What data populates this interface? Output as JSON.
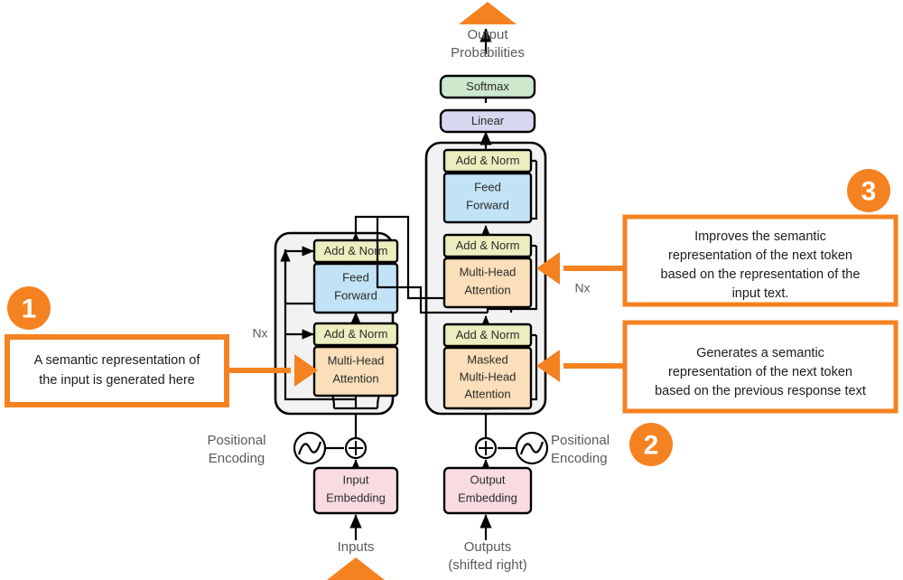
{
  "figure": {
    "title": "Annotated Transformer architecture",
    "colors": {
      "accent_orange": "#F58220",
      "add_norm_fill": "#EDEEC0",
      "attention_fill": "#FBDFBA",
      "feed_forward_fill": "#C2E3F5",
      "embedding_fill": "#F8DCE2",
      "softmax_fill": "#CDE8CD",
      "linear_fill": "#D5D8EE",
      "stack_fill": "#F2F2F2",
      "stroke_black": "#000000",
      "text_gray": "#5a5a5a"
    }
  },
  "top": {
    "output_probabilities_line1": "Output",
    "output_probabilities_line2": "Probabilities",
    "softmax": "Softmax",
    "linear": "Linear"
  },
  "encoder": {
    "nx_label": "Nx",
    "add_norm_upper": "Add & Norm",
    "feed_forward_line1": "Feed",
    "feed_forward_line2": "Forward",
    "add_norm_lower": "Add & Norm",
    "attention_line1": "Multi-Head",
    "attention_line2": "Attention"
  },
  "decoder": {
    "nx_label": "Nx",
    "add_norm_top": "Add & Norm",
    "feed_forward_line1": "Feed",
    "feed_forward_line2": "Forward",
    "add_norm_middle": "Add & Norm",
    "cross_attention_line1": "Multi-Head",
    "cross_attention_line2": "Attention",
    "add_norm_bottom": "Add & Norm",
    "masked_attention_line1": "Masked",
    "masked_attention_line2": "Multi-Head",
    "masked_attention_line3": "Attention"
  },
  "bottom": {
    "input_positional_line1": "Positional",
    "input_positional_line2": "Encoding",
    "output_positional_line1": "Positional",
    "output_positional_line2": "Encoding",
    "input_embedding_line1": "Input",
    "input_embedding_line2": "Embedding",
    "output_embedding_line1": "Output",
    "output_embedding_line2": "Embedding",
    "inputs_label": "Inputs",
    "outputs_label_line1": "Outputs",
    "outputs_label_line2": "(shifted right)",
    "plus_symbol": "+"
  },
  "callouts": [
    {
      "badge": "1",
      "lines": [
        "A semantic representation of",
        "the input is generated here"
      ]
    },
    {
      "badge": "2",
      "lines": [
        "Generates a semantic",
        "representation of the next token",
        "based on the previous response text"
      ]
    },
    {
      "badge": "3",
      "lines": [
        "Improves the semantic",
        "representation of the next token",
        "based on the representation of the",
        "input text."
      ]
    }
  ]
}
